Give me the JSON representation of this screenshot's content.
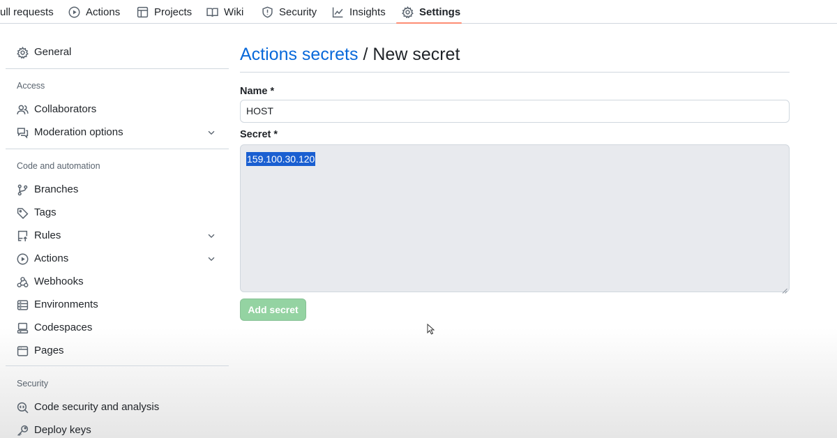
{
  "topnav": {
    "tabs": [
      {
        "label": "ull requests",
        "icon": "pull-request-icon"
      },
      {
        "label": "Actions",
        "icon": "play-icon"
      },
      {
        "label": "Projects",
        "icon": "table-icon"
      },
      {
        "label": "Wiki",
        "icon": "book-icon"
      },
      {
        "label": "Security",
        "icon": "shield-icon"
      },
      {
        "label": "Insights",
        "icon": "graph-icon"
      },
      {
        "label": "Settings",
        "icon": "gear-icon",
        "selected": true
      }
    ],
    "accent_color": "#fd8c73"
  },
  "sidebar": {
    "general": "General",
    "access_heading": "Access",
    "collaborators": "Collaborators",
    "moderation": "Moderation options",
    "code_heading": "Code and automation",
    "branches": "Branches",
    "tags": "Tags",
    "rules": "Rules",
    "actions": "Actions",
    "webhooks": "Webhooks",
    "environments": "Environments",
    "codespaces": "Codespaces",
    "pages": "Pages",
    "security_heading": "Security",
    "code_security": "Code security and analysis",
    "deploy_keys": "Deploy keys"
  },
  "main": {
    "breadcrumb_link": "Actions secrets",
    "separator": "/",
    "title": "New secret",
    "name_label": "Name *",
    "name_value": "HOST",
    "secret_label": "Secret *",
    "secret_value": "159.100.30.120",
    "add_button": "Add secret",
    "link_color": "#0969da",
    "button_color": "#94d3a2"
  }
}
